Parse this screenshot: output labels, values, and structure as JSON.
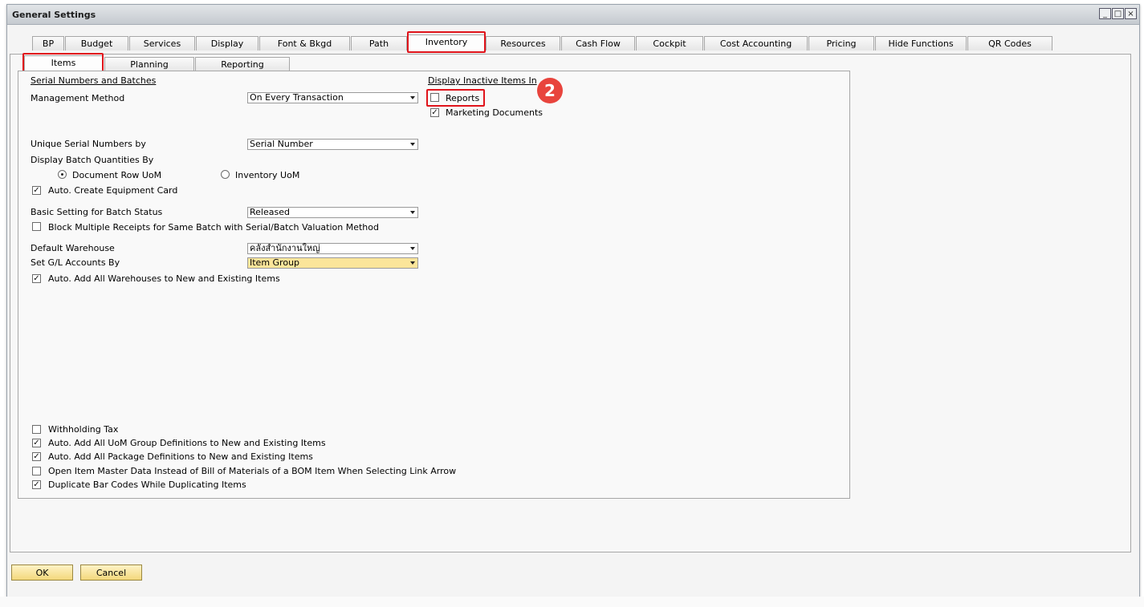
{
  "window": {
    "title": "General Settings"
  },
  "window_controls": {
    "minimize": "_",
    "maximize": "□",
    "close": "×"
  },
  "tabs": {
    "bp": "BP",
    "budget": "Budget",
    "services": "Services",
    "display": "Display",
    "font": "Font & Bkgd",
    "path": "Path",
    "inventory": "Inventory",
    "resources": "Resources",
    "cashflow": "Cash Flow",
    "cockpit": "Cockpit",
    "costacc": "Cost Accounting",
    "pricing": "Pricing",
    "hidefunc": "Hide Functions",
    "qrcodes": "QR Codes"
  },
  "subtabs": {
    "items": "Items",
    "planning": "Planning",
    "reporting": "Reporting"
  },
  "serial": {
    "section": "Serial Numbers and Batches",
    "mgmt_label": "Management Method",
    "mgmt_value": "On Every Transaction",
    "unique_label": "Unique Serial Numbers by",
    "unique_value": "Serial Number",
    "batchqty_label": "Display Batch Quantities By",
    "radio_docrow": "Document Row UoM",
    "radio_inventory": "Inventory UoM",
    "auto_equipment": "Auto. Create Equipment Card",
    "batch_status_label": "Basic Setting for Batch Status",
    "batch_status_value": "Released",
    "block_receipts": "Block Multiple Receipts for Same Batch with Serial/Batch Valuation Method",
    "warehouse_label": "Default Warehouse",
    "warehouse_value": "คลังสำนักงานใหญ่",
    "gl_label": "Set G/L Accounts By",
    "gl_value": "Item Group",
    "auto_warehouses": "Auto. Add All Warehouses to New and Existing Items"
  },
  "inactive": {
    "section": "Display Inactive Items In",
    "reports": "Reports",
    "marketing": "Marketing Documents"
  },
  "annotation": {
    "step": "2"
  },
  "bottom": {
    "withholding": "Withholding Tax",
    "uom_group": "Auto. Add All UoM Group Definitions to New and Existing Items",
    "package": "Auto. Add All Package Definitions to New and Existing Items",
    "open_master": "Open Item Master Data Instead of Bill of Materials of a BOM Item When Selecting Link Arrow",
    "dup_barcodes": "Duplicate Bar Codes While Duplicating Items"
  },
  "checks": {
    "reports": false,
    "marketing": true,
    "auto_equipment": true,
    "block_receipts": false,
    "auto_warehouses": true,
    "withholding": false,
    "uom_group": true,
    "package": true,
    "open_master": false,
    "dup_barcodes": true
  },
  "radios": {
    "selected": "Document Row UoM"
  },
  "buttons": {
    "ok": "OK",
    "cancel": "Cancel"
  },
  "colors": {
    "highlight": "#e0141b",
    "badge": "#e8443d",
    "combo_highlight": "#fbe59a",
    "button": "#f3d87c"
  }
}
